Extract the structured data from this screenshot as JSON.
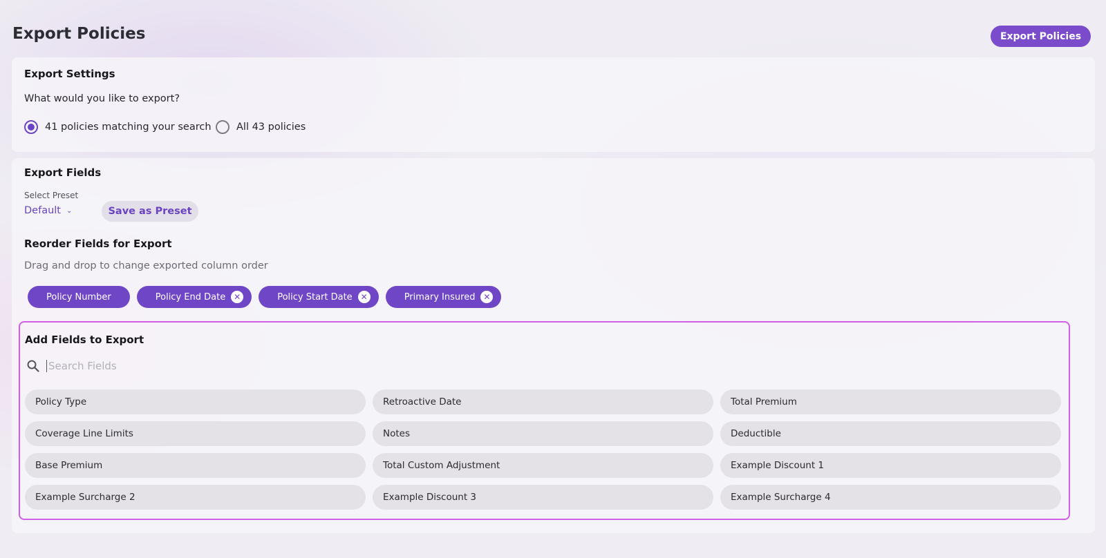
{
  "header": {
    "title": "Export Policies",
    "export_button": "Export Policies"
  },
  "settings": {
    "title": "Export Settings",
    "question": "What would you like to export?",
    "options": [
      {
        "label": "41 policies matching your search",
        "selected": true
      },
      {
        "label": "All 43 policies",
        "selected": false
      }
    ]
  },
  "fields": {
    "title": "Export Fields",
    "preset_label": "Select Preset",
    "preset_value": "Default",
    "save_preset": "Save as Preset",
    "reorder_title": "Reorder Fields for Export",
    "reorder_hint": "Drag and drop to change exported column order",
    "selected": [
      {
        "label": "Policy Number",
        "removable": false
      },
      {
        "label": "Policy End Date",
        "removable": true
      },
      {
        "label": "Policy Start Date",
        "removable": true
      },
      {
        "label": "Primary Insured",
        "removable": true
      }
    ],
    "add_title": "Add Fields to Export",
    "search_placeholder": "Search Fields",
    "available": [
      "Policy Type",
      "Retroactive Date",
      "Total Premium",
      "Coverage Line Limits",
      "Notes",
      "Deductible",
      "Base Premium",
      "Total Custom Adjustment",
      "Example Discount 1",
      "Example Surcharge 2",
      "Example Discount 3",
      "Example Surcharge 4"
    ]
  },
  "colors": {
    "accent": "#7a4bcb",
    "highlight_border": "#d05ee6"
  },
  "icons": {
    "search": "search-icon",
    "chevron": "chevron-down-icon",
    "remove": "close-icon"
  }
}
